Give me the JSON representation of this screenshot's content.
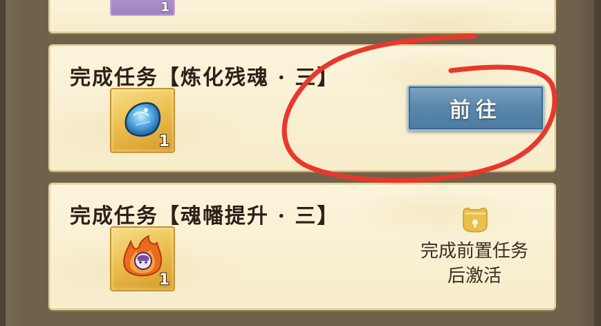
{
  "tasks": [
    {
      "title": "",
      "reward_qty": "1",
      "reward_icon": "purple-item-icon"
    },
    {
      "title": "完成任务【炼化残魂 · 三】",
      "reward_qty": "1",
      "reward_icon": "blue-soul-stone-icon",
      "action_label": "前往"
    },
    {
      "title": "完成任务【魂幡提升 · 三】",
      "reward_qty": "1",
      "reward_icon": "flame-soul-orb-icon",
      "locked_text_line1": "完成前置任务",
      "locked_text_line2": "后激活",
      "lock_icon": "gold-lock-icon"
    }
  ],
  "colors": {
    "annotation": "#e8382c",
    "button": "#5a86ab",
    "card": "#f8efcf",
    "lock": "#e6bd4a"
  }
}
